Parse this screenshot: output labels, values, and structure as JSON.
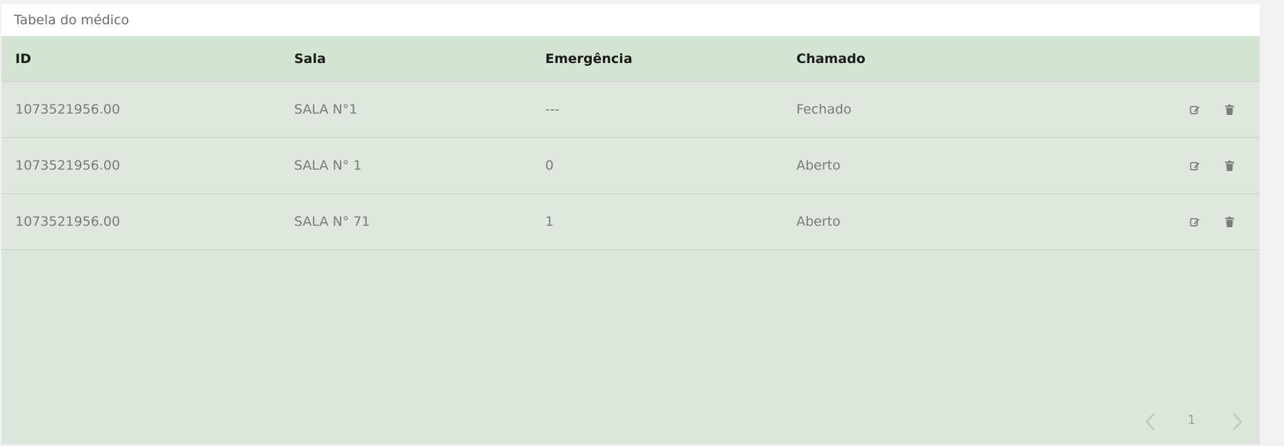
{
  "panel": {
    "title": "Tabela do médico"
  },
  "table": {
    "headers": {
      "id": "ID",
      "sala": "Sala",
      "emergencia": "Emergência",
      "chamado": "Chamado"
    },
    "rows": [
      {
        "id": "1073521956.00",
        "sala": "SALA N°1",
        "emergencia": "---",
        "chamado": "Fechado"
      },
      {
        "id": "1073521956.00",
        "sala": "SALA N° 1",
        "emergencia": "0",
        "chamado": "Aberto"
      },
      {
        "id": "1073521956.00",
        "sala": "SALA N° 71",
        "emergencia": "1",
        "chamado": "Aberto"
      }
    ],
    "row_actions": [
      "edit-icon",
      "trash-icon"
    ]
  },
  "pagination": {
    "current_page": "1",
    "prev_icon": "chevron-left-icon",
    "next_icon": "chevron-right-icon"
  },
  "colors": {
    "header_bg": "#d3e5d2",
    "body_bg": "#dde6dc",
    "icon": "#7d7d7d"
  }
}
